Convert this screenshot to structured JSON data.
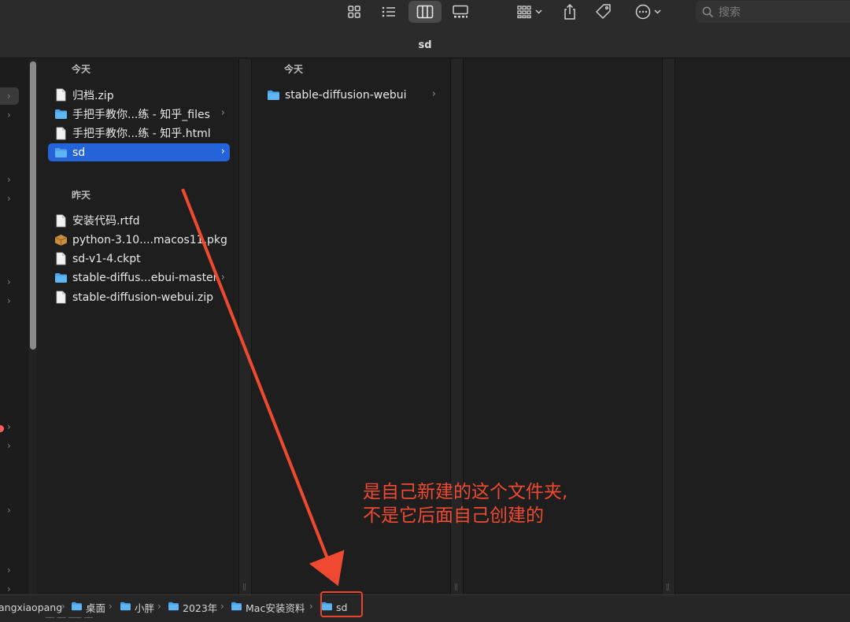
{
  "window": {
    "title": "sd"
  },
  "toolbar": {
    "icons": [
      "grid-view-icon",
      "list-view-icon",
      "column-view-icon",
      "gallery-view-icon",
      "group-icon",
      "share-icon",
      "tag-icon",
      "more-icon"
    ],
    "search_placeholder": "搜索"
  },
  "columns": [
    {
      "sections": [
        {
          "header": "今天",
          "items": [
            {
              "name": "归档.zip",
              "kind": "file",
              "has_arrow": false,
              "selected": false
            },
            {
              "name": "手把手教你...练 - 知乎_files",
              "kind": "folder",
              "has_arrow": true,
              "selected": false
            },
            {
              "name": "手把手教你...练 - 知乎.html",
              "kind": "file",
              "has_arrow": false,
              "selected": false
            },
            {
              "name": "sd",
              "kind": "folder",
              "has_arrow": true,
              "selected": true
            }
          ]
        },
        {
          "header": "昨天",
          "items": [
            {
              "name": "安装代码.rtfd",
              "kind": "file",
              "has_arrow": false,
              "selected": false
            },
            {
              "name": "python-3.10....macos11.pkg",
              "kind": "package",
              "has_arrow": false,
              "selected": false
            },
            {
              "name": "sd-v1-4.ckpt",
              "kind": "file",
              "has_arrow": false,
              "selected": false
            },
            {
              "name": "stable-diffus...ebui-master",
              "kind": "folder",
              "has_arrow": true,
              "selected": false
            },
            {
              "name": "stable-diffusion-webui.zip",
              "kind": "file",
              "has_arrow": false,
              "selected": false
            }
          ]
        }
      ]
    },
    {
      "sections": [
        {
          "header": "今天",
          "items": [
            {
              "name": "stable-diffusion-webui",
              "kind": "folder",
              "has_arrow": true,
              "selected": false
            }
          ]
        }
      ]
    }
  ],
  "pathbar": {
    "crumbs": [
      "angxiaopang",
      "桌面",
      "小胖",
      "2023年",
      "Mac安装资料",
      "sd"
    ]
  },
  "annotation": {
    "line1": "是自己新建的这个文件夹,",
    "line2": "不是它后面自己创建的",
    "color": "#ef4a31"
  },
  "colors": {
    "selection": "#2563d8",
    "folder": "#4aa3e8",
    "annotation": "#ef4a31"
  }
}
